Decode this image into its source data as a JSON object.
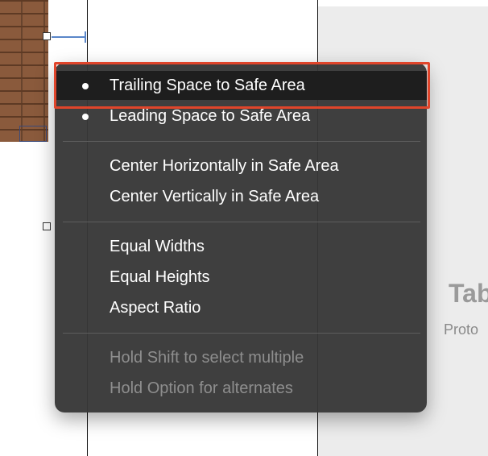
{
  "canvas": {
    "panel_title": "Tab",
    "panel_subtitle": "Proto"
  },
  "menu": {
    "items": [
      {
        "label": "Trailing Space to Safe Area",
        "bullet": true,
        "selected": true
      },
      {
        "label": "Leading Space to Safe Area",
        "bullet": true
      },
      {
        "label": "Center Horizontally in Safe Area"
      },
      {
        "label": "Center Vertically in Safe Area"
      },
      {
        "label": "Equal Widths"
      },
      {
        "label": "Equal Heights"
      },
      {
        "label": "Aspect Ratio"
      },
      {
        "label": "Hold Shift to select multiple",
        "disabled": true
      },
      {
        "label": "Hold Option for alternates",
        "disabled": true
      }
    ]
  },
  "colors": {
    "menu_bg": "#373737",
    "highlight_outline": "#e0452b",
    "constraint": "#5a86c9"
  }
}
